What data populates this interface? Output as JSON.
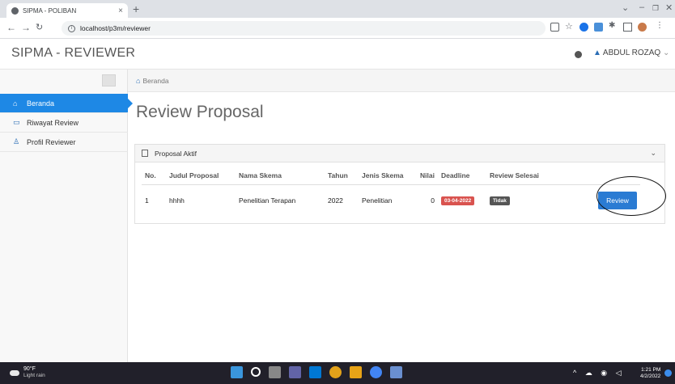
{
  "browser": {
    "tab_title": "SIPMA - POLIBAN",
    "tab_close": "×",
    "new_tab": "+",
    "url": "localhost/p3m/reviewer",
    "info": "i"
  },
  "app": {
    "brand": "SIPMA - REVIEWER",
    "user_name": "ABDUL ROZAQ",
    "user_caret": "⌄"
  },
  "sidebar": {
    "items": [
      {
        "label": "Beranda",
        "icon": "home-icon"
      },
      {
        "label": "Riwayat Review",
        "icon": "monitor-icon"
      },
      {
        "label": "Profil Reviewer",
        "icon": "user-icon"
      }
    ]
  },
  "breadcrumb": {
    "label": "Beranda"
  },
  "page": {
    "title": "Review Proposal"
  },
  "card": {
    "title": "Proposal Aktif",
    "columns": [
      "No.",
      "Judul Proposal",
      "Nama Skema",
      "Tahun",
      "Jenis Skema",
      "Nilai",
      "Deadline",
      "Review Selesai"
    ],
    "rows": [
      {
        "no": "1",
        "judul": "hhhh",
        "skema": "Penelitian Terapan",
        "tahun": "2022",
        "jenis": "Penelitian",
        "nilai": "0",
        "deadline": "03-04-2022",
        "selesai": "Tidak",
        "action": "Review"
      }
    ]
  },
  "taskbar": {
    "temp": "90°F",
    "weather": "Light rain",
    "time": "1:21 PM",
    "date": "4/2/2022"
  },
  "colors": {
    "accent": "#1e88e5",
    "button": "#2a7bd3",
    "deadline_badge": "#d9534f",
    "status_badge": "#555555"
  }
}
